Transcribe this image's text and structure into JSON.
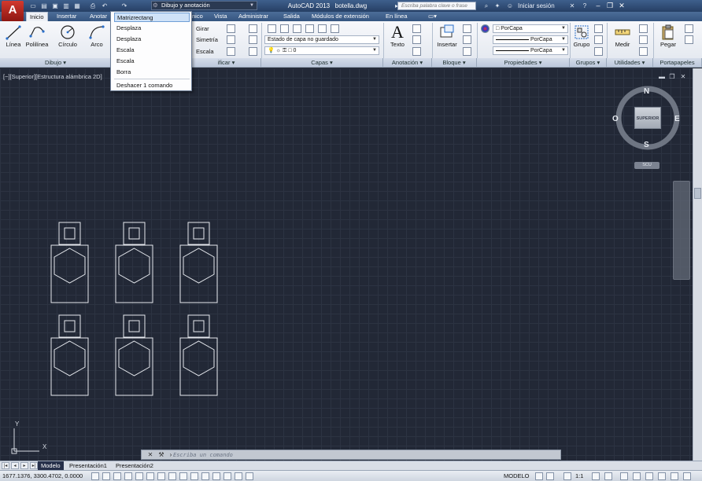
{
  "title_bar": {
    "workspace": "Dibujo y anotación",
    "app_name": "AutoCAD 2013",
    "file_name": "botella.dwg",
    "search_placeholder": "Escriba palabra clave o frase",
    "signin": "Iniciar sesión"
  },
  "tabs": [
    "Inicio",
    "Insertar",
    "Anotar",
    "nico",
    "Vista",
    "Administrar",
    "Salida",
    "Módulos de extensión",
    "En línea"
  ],
  "ribbon": {
    "draw_tools": [
      "Línea",
      "Polilínea",
      "Círculo",
      "Arco"
    ],
    "modify_tools": [
      "Girar",
      "Simetría",
      "Escala"
    ],
    "layer_state": "Estado de capa no guardado",
    "layer_current": "0",
    "annotation_tool": "Texto",
    "block_tool": "Insertar",
    "properties": [
      "PorCapa",
      "PorCapa",
      "PorCapa"
    ],
    "group_tool": "Grupo",
    "utility_tool": "Medir",
    "clipboard_tool": "Pegar",
    "panels": [
      "Dibujo",
      "ificar",
      "Capas",
      "Anotación",
      "Bloque",
      "Propiedades",
      "Grupos",
      "Utilidades",
      "Portapapeles"
    ]
  },
  "undo_menu": {
    "items": [
      "Matrizrectang",
      "Desplaza",
      "Desplaza",
      "Escala",
      "Escala",
      "Borra"
    ],
    "footer": "Deshacer 1 comando"
  },
  "viewport": {
    "label": "[−][Superior][Estructura alámbrica 2D]"
  },
  "viewcube": {
    "north": "N",
    "south": "S",
    "east": "E",
    "west": "O",
    "face": "SUPERIOR",
    "wcs": "SCU"
  },
  "ucs": {
    "x": "X",
    "y": "Y"
  },
  "command_line": {
    "placeholder": "Escriba un comando"
  },
  "layout_tabs": [
    "Modelo",
    "Presentación1",
    "Presentación2"
  ],
  "status_bar": {
    "coordinates": "1677.1376, 3300.4702, 0.0000",
    "space": "MODELO",
    "scale": "1:1"
  },
  "colors": {
    "accent": "#3e5f8c",
    "canvas": "#222836",
    "ribbon": "#eef1f6"
  }
}
